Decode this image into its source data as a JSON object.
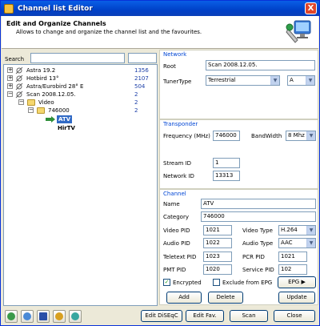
{
  "window": {
    "title": "Channel list Editor",
    "close_label": "X"
  },
  "header": {
    "title": "Edit and Organize Channels",
    "description": "Allows to change and organize the channel list and the favourites."
  },
  "search": {
    "label": "Search",
    "value": "",
    "value2": ""
  },
  "tree": {
    "items": [
      {
        "expander": "+",
        "label": "Astra 19.2",
        "count": "1356"
      },
      {
        "expander": "+",
        "label": "Hotbird 13°",
        "count": "2107"
      },
      {
        "expander": "+",
        "label": "Astra/Eurobird 28° E",
        "count": "504"
      },
      {
        "expander": "−",
        "label": "Scan 2008.12.05.",
        "count": "2"
      },
      {
        "expander": "−",
        "label": "Video",
        "count": "2"
      },
      {
        "expander": "−",
        "label": "746000",
        "count": "2"
      },
      {
        "label": "ATV"
      },
      {
        "label": "HirTV"
      }
    ]
  },
  "network": {
    "title": "Network",
    "root_label": "Root",
    "root_value": "Scan 2008.12.05.",
    "tunertype_label": "TunerType",
    "tunertype_value": "Terrestrial",
    "tuner_letter": "A"
  },
  "transponder": {
    "title": "Transponder",
    "frequency_label": "Frequency (MHz)",
    "frequency_value": "746000",
    "bandwidth_label": "BandWidth",
    "bandwidth_value": "8 Mhz",
    "stream_id_label": "Stream ID",
    "stream_id_value": "1",
    "network_id_label": "Network ID",
    "network_id_value": "13313"
  },
  "channel": {
    "title": "Channel",
    "name_label": "Name",
    "name_value": "ATV",
    "category_label": "Category",
    "category_value": "746000",
    "video_pid_label": "Video PID",
    "video_pid_value": "1021",
    "video_type_label": "Video Type",
    "video_type_value": "H.264",
    "audio_pid_label": "Audio PID",
    "audio_pid_value": "1022",
    "audio_type_label": "Audio Type",
    "audio_type_value": "AAC",
    "teletext_pid_label": "Teletext PID",
    "teletext_pid_value": "1023",
    "pcr_pid_label": "PCR PID",
    "pcr_pid_value": "1021",
    "pmt_pid_label": "PMT PID",
    "pmt_pid_value": "1020",
    "service_pid_label": "Service PID",
    "service_pid_value": "102",
    "encrypted_label": "Encrypted",
    "encrypted_checked": "✓",
    "exclude_epg_label": "Exclude from EPG",
    "epg_button": "EPG",
    "add_button": "Add",
    "delete_button": "Delete",
    "update_button": "Update"
  },
  "footer": {
    "edit_diseqc": "Edit DiSEqC",
    "edit_fav": "Edit Fav.",
    "scan": "Scan",
    "close": "Close"
  },
  "toolbar_icons": [
    "satellite-add-icon",
    "satellite-edit-icon",
    "save-icon",
    "undo-icon",
    "refresh-icon"
  ],
  "colors": {
    "title_bar": "#0041c8",
    "group_title": "#0046d5",
    "count_text": "#1c3fa8",
    "selection": "#316ac5"
  }
}
